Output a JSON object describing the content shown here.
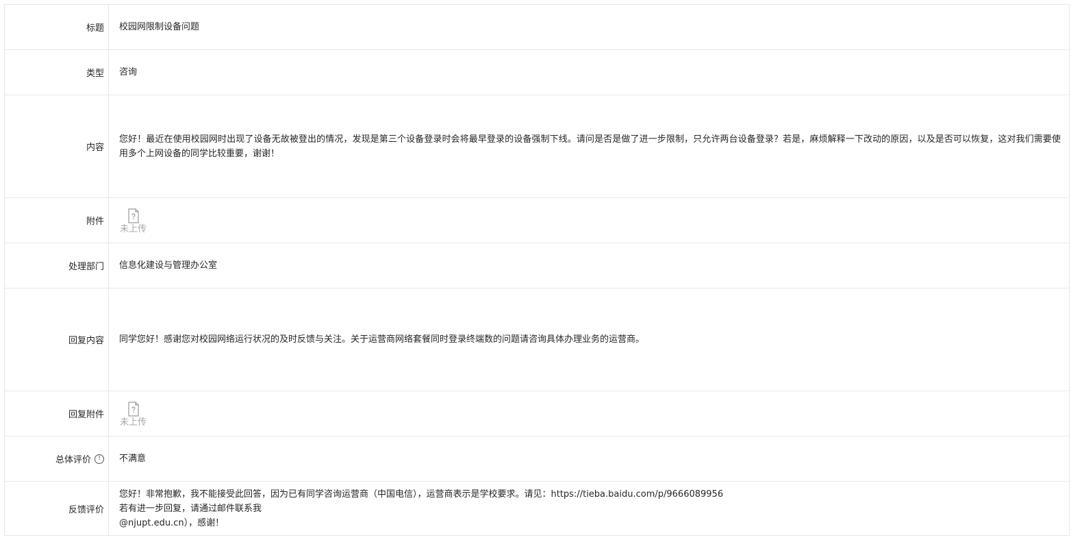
{
  "rows": {
    "title": {
      "label": "标题",
      "value": "校园网限制设备问题"
    },
    "type": {
      "label": "类型",
      "value": "咨询"
    },
    "content": {
      "label": "内容",
      "value": "您好！最近在使用校园网时出现了设备无故被登出的情况，发现是第三个设备登录时会将最早登录的设备强制下线。请问是否是做了进一步限制，只允许两台设备登录？若是，麻烦解释一下改动的原因，以及是否可以恢复，这对我们需要使用多个上网设备的同学比较重要，谢谢！"
    },
    "attachment": {
      "label": "附件",
      "status": "未上传",
      "icon": "file-question-icon"
    },
    "department": {
      "label": "处理部门",
      "value": "信息化建设与管理办公室"
    },
    "reply": {
      "label": "回复内容",
      "value": "同学您好！感谢您对校园网络运行状况的及时反馈与关注。关于运营商网络套餐同时登录终端数的问题请咨询具体办理业务的运营商。"
    },
    "reply_attachment": {
      "label": "回复附件",
      "status": "未上传",
      "icon": "file-question-icon"
    },
    "rating": {
      "label": "总体评价",
      "info_icon": "info-icon",
      "info_glyph": "!",
      "value": "不满意"
    },
    "feedback": {
      "label": "反馈评价",
      "line1": "您好！非常抱歉，我不能接受此回答，因为已有同学咨询运营商（中国电信），运营商表示是学校要求。请见：https://tieba.baidu.com/p/9666089956",
      "line2_prefix": "若有进一步回复，请通过邮件联系我",
      "line2_suffix": "@njupt.edu.cn），感谢！"
    }
  },
  "colors": {
    "border": "#e8e8e8",
    "text": "#262626",
    "muted": "#a8a8a8"
  }
}
